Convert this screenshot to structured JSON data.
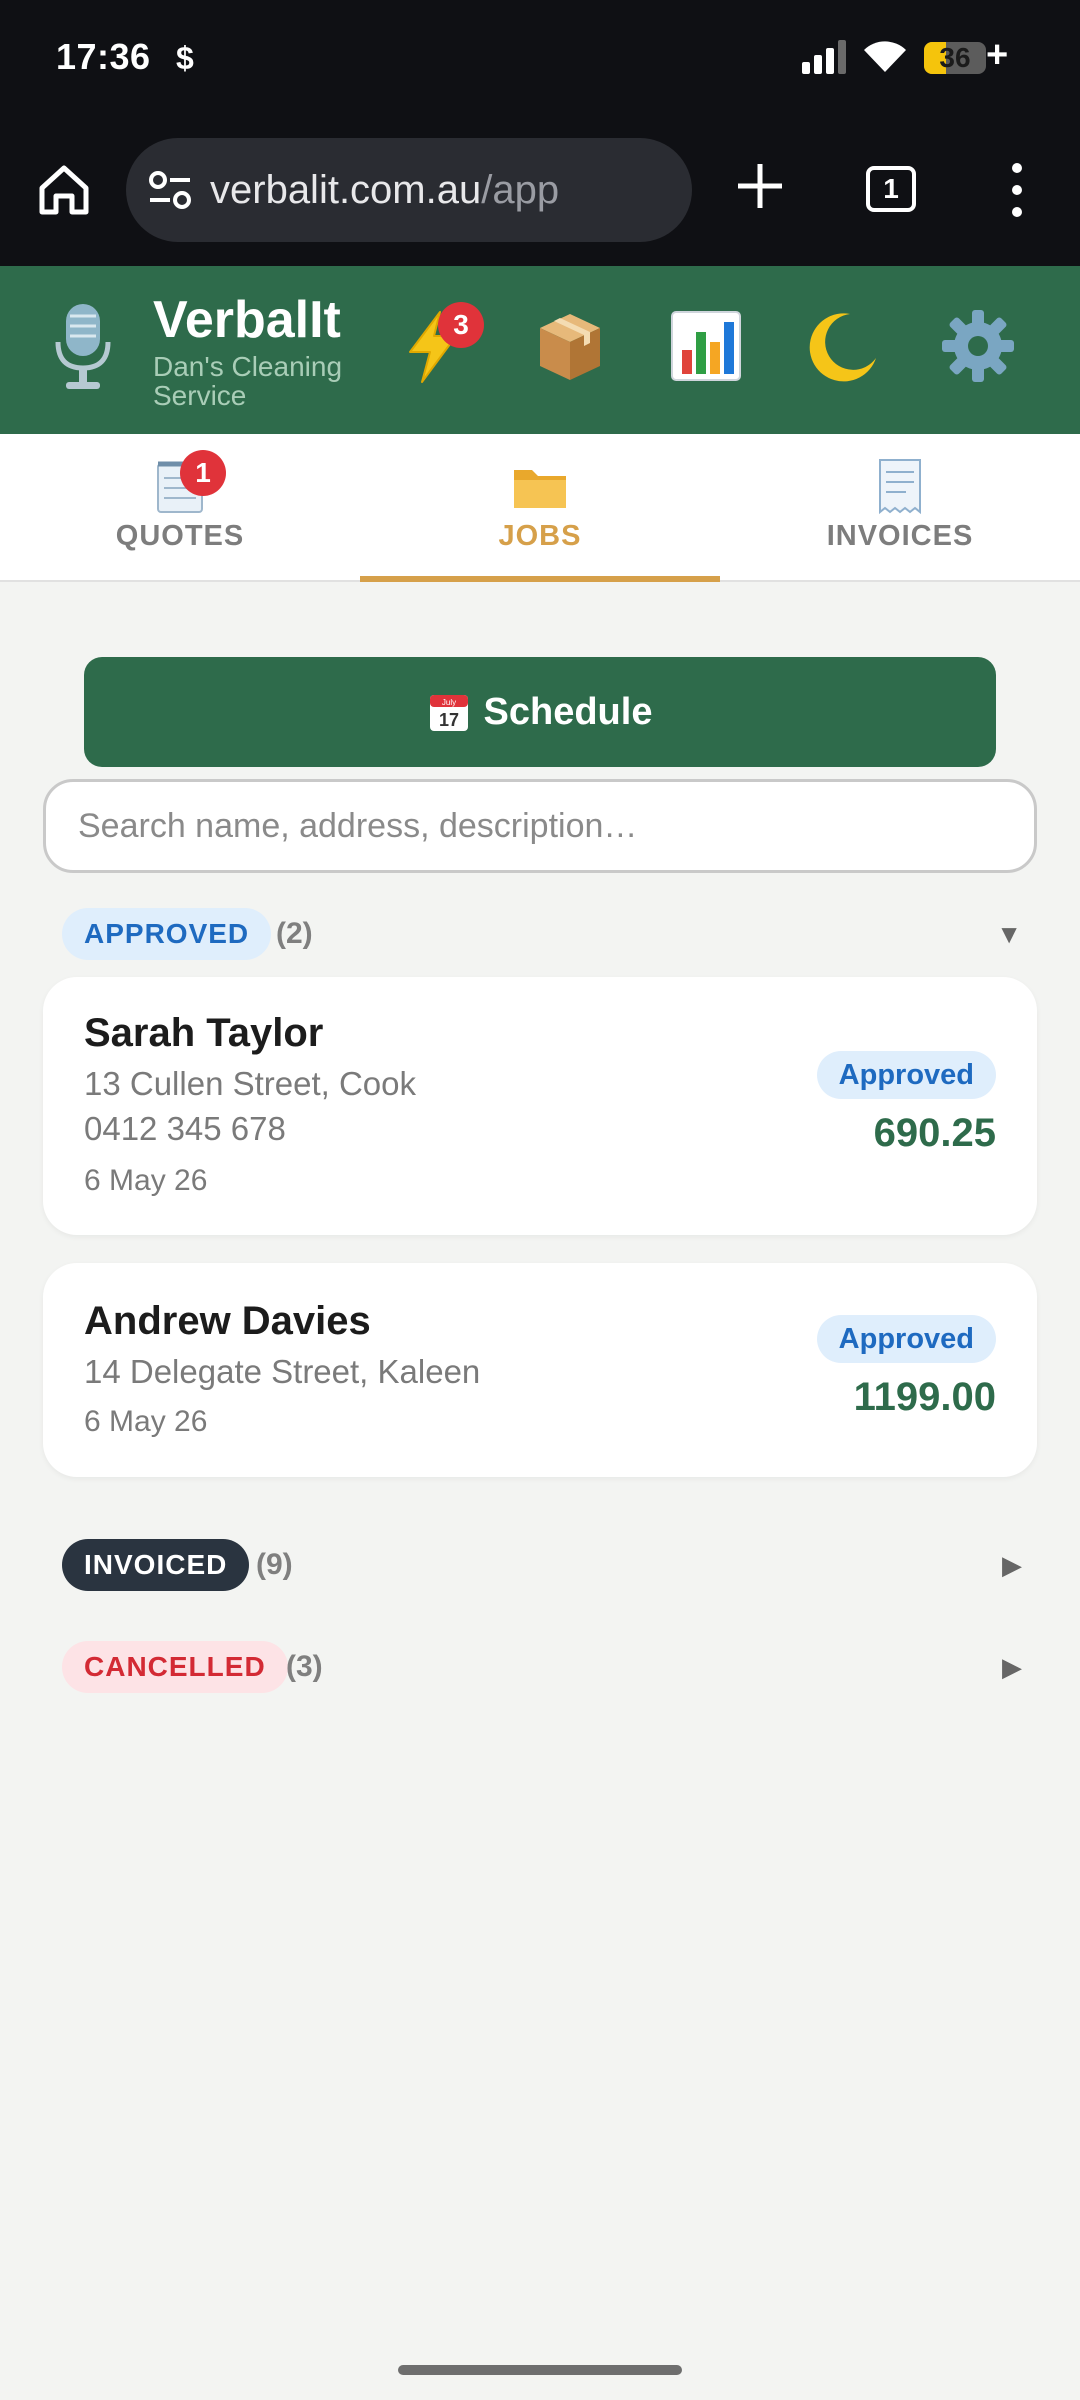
{
  "status_bar": {
    "time": "17:36",
    "dollar": "$",
    "battery": {
      "level_percent": 36,
      "text": "36",
      "plus": "+"
    },
    "icons": [
      "signal-icon",
      "wifi-icon",
      "battery-icon"
    ]
  },
  "browser": {
    "url_domain": "verbalit.com.au",
    "url_path": "/app",
    "tab_count": "1",
    "icons": [
      "home-icon",
      "site-settings-icon",
      "plus-icon",
      "tabs-icon",
      "more-vert-icon"
    ]
  },
  "app_header": {
    "title": "VerbalIt",
    "subtitle": "Dan's Cleaning Service",
    "notification_count": "3",
    "icons": [
      "microphone-icon",
      "lightning-icon",
      "package-icon",
      "chart-icon",
      "moon-icon",
      "gear-icon"
    ],
    "colors": {
      "header": "#2e6b4b",
      "accent": "#d6a04a",
      "badge": "#e0333a"
    }
  },
  "tabs": [
    {
      "label": "QUOTES",
      "icon": "notepad-icon",
      "badge": "1",
      "active": false
    },
    {
      "label": "JOBS",
      "icon": "folder-icon",
      "active": true
    },
    {
      "label": "INVOICES",
      "icon": "receipt-icon",
      "active": false
    }
  ],
  "schedule": {
    "label": "Schedule",
    "icon": "calendar-icon",
    "calendar_month": "July",
    "calendar_day": "17"
  },
  "search": {
    "placeholder": "Search name, address, description…",
    "value": ""
  },
  "groups": {
    "approved": {
      "label": "APPROVED",
      "count": "(2)",
      "expanded": true,
      "caret": "▼",
      "jobs": [
        {
          "name": "Sarah Taylor",
          "address": "13 Cullen Street, Cook",
          "phone": "0412 345 678",
          "date": "6 May 26",
          "status": "Approved",
          "amount": "690.25"
        },
        {
          "name": "Andrew Davies",
          "address": "14 Delegate Street, Kaleen",
          "date": "6 May 26",
          "status": "Approved",
          "amount": "1199.00"
        }
      ]
    },
    "invoiced": {
      "label": "INVOICED",
      "count": "(9)",
      "expanded": false,
      "caret": "▶"
    },
    "cancelled": {
      "label": "CANCELLED",
      "count": "(3)",
      "expanded": false,
      "caret": "▶"
    }
  }
}
